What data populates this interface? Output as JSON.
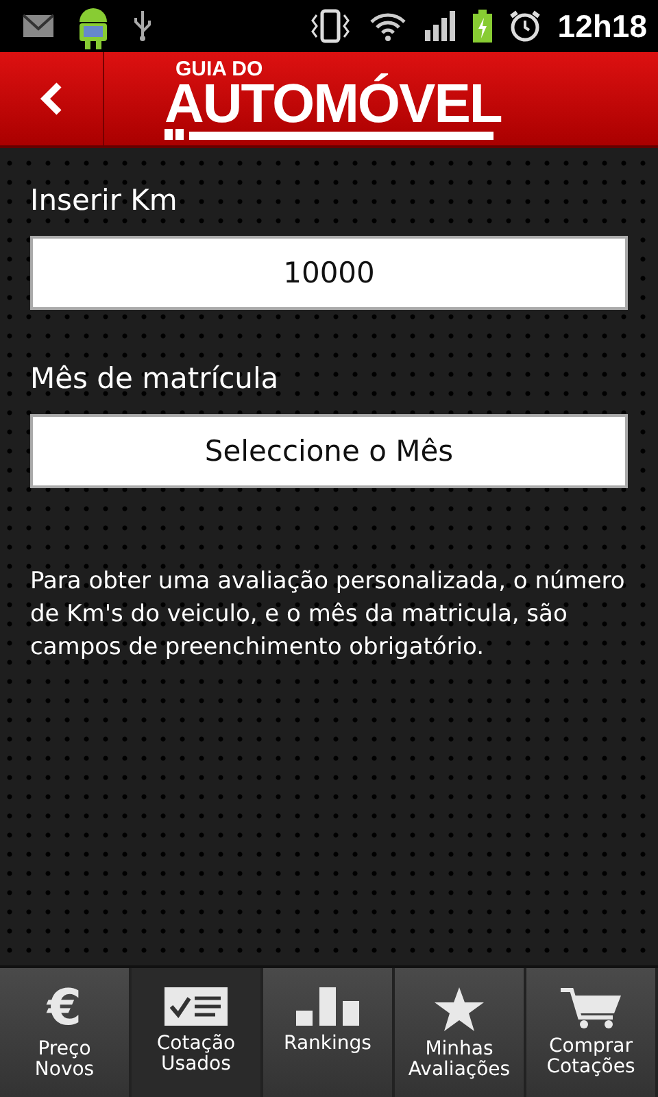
{
  "status_bar": {
    "time": "12h18",
    "battery_charging": true
  },
  "header": {
    "logo_small": "GUIA DO",
    "logo_big": "AUTOMÓVEL"
  },
  "form": {
    "km_label": "Inserir Km",
    "km_value": "10000",
    "month_label": "Mês de matrícula",
    "month_button": "Seleccione o Mês",
    "note": "Para obter uma avaliação personalizada, o número de Km's do veiculo, e o mês da matricula, são campos de preenchimento obrigatório."
  },
  "tabs": [
    {
      "kind": "euro",
      "glyph": "€",
      "label": "Preço\nNovos",
      "selected": false
    },
    {
      "kind": "checklist",
      "label": "Cotação\nUsados",
      "selected": true
    },
    {
      "kind": "bars",
      "label": "Rankings",
      "selected": false
    },
    {
      "kind": "star",
      "label": "Minhas\nAvaliações",
      "selected": false
    },
    {
      "kind": "cart",
      "label": "Comprar\nCotações",
      "selected": false
    }
  ]
}
